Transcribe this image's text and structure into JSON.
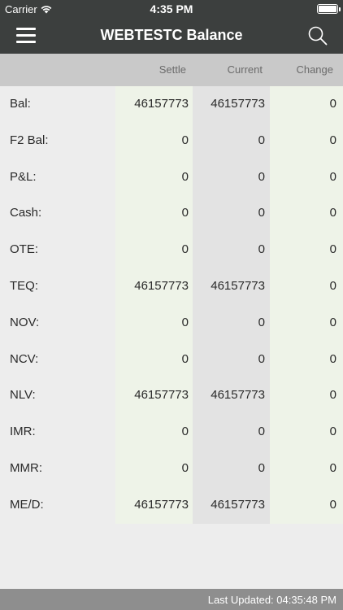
{
  "status_bar": {
    "carrier": "Carrier",
    "time": "4:35 PM",
    "wifi_icon": "wifi-icon",
    "battery_icon": "battery-icon"
  },
  "nav": {
    "title": "WEBTESTC Balance",
    "menu_icon": "hamburger-menu-icon",
    "search_icon": "search-icon"
  },
  "columns": {
    "settle": "Settle",
    "current": "Current",
    "change": "Change"
  },
  "rows": [
    {
      "label": "Bal:",
      "settle": "46157773",
      "current": "46157773",
      "change": "0"
    },
    {
      "label": "F2 Bal:",
      "settle": "0",
      "current": "0",
      "change": "0"
    },
    {
      "label": "P&L:",
      "settle": "0",
      "current": "0",
      "change": "0"
    },
    {
      "label": "Cash:",
      "settle": "0",
      "current": "0",
      "change": "0"
    },
    {
      "label": "OTE:",
      "settle": "0",
      "current": "0",
      "change": "0"
    },
    {
      "label": "TEQ:",
      "settle": "46157773",
      "current": "46157773",
      "change": "0"
    },
    {
      "label": "NOV:",
      "settle": "0",
      "current": "0",
      "change": "0"
    },
    {
      "label": "NCV:",
      "settle": "0",
      "current": "0",
      "change": "0"
    },
    {
      "label": "NLV:",
      "settle": "46157773",
      "current": "46157773",
      "change": "0"
    },
    {
      "label": "IMR:",
      "settle": "0",
      "current": "0",
      "change": "0"
    },
    {
      "label": "MMR:",
      "settle": "0",
      "current": "0",
      "change": "0"
    },
    {
      "label": "ME/D:",
      "settle": "46157773",
      "current": "46157773",
      "change": "0"
    }
  ],
  "footer": {
    "last_updated": "Last Updated: 04:35:48 PM"
  },
  "colors": {
    "nav_background": "#3c3f3e",
    "header_band": "#c9c9c9",
    "settle_column": "#eef3e8",
    "current_column": "#e3e3e3",
    "footer_background": "#8e8e8e"
  }
}
